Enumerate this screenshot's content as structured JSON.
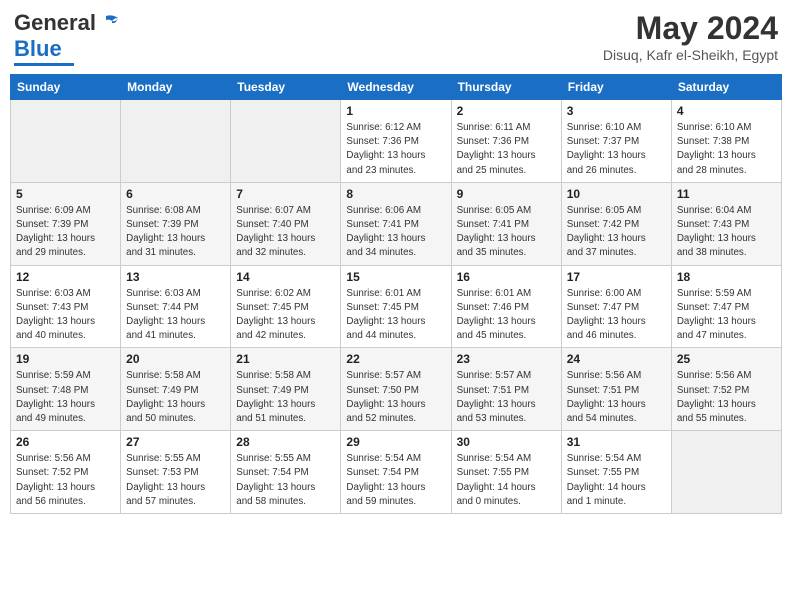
{
  "header": {
    "logo_general": "General",
    "logo_blue": "Blue",
    "month_title": "May 2024",
    "location": "Disuq, Kafr el-Sheikh, Egypt"
  },
  "days_of_week": [
    "Sunday",
    "Monday",
    "Tuesday",
    "Wednesday",
    "Thursday",
    "Friday",
    "Saturday"
  ],
  "weeks": [
    [
      {
        "day": "",
        "info": ""
      },
      {
        "day": "",
        "info": ""
      },
      {
        "day": "",
        "info": ""
      },
      {
        "day": "1",
        "info": "Sunrise: 6:12 AM\nSunset: 7:36 PM\nDaylight: 13 hours\nand 23 minutes."
      },
      {
        "day": "2",
        "info": "Sunrise: 6:11 AM\nSunset: 7:36 PM\nDaylight: 13 hours\nand 25 minutes."
      },
      {
        "day": "3",
        "info": "Sunrise: 6:10 AM\nSunset: 7:37 PM\nDaylight: 13 hours\nand 26 minutes."
      },
      {
        "day": "4",
        "info": "Sunrise: 6:10 AM\nSunset: 7:38 PM\nDaylight: 13 hours\nand 28 minutes."
      }
    ],
    [
      {
        "day": "5",
        "info": "Sunrise: 6:09 AM\nSunset: 7:39 PM\nDaylight: 13 hours\nand 29 minutes."
      },
      {
        "day": "6",
        "info": "Sunrise: 6:08 AM\nSunset: 7:39 PM\nDaylight: 13 hours\nand 31 minutes."
      },
      {
        "day": "7",
        "info": "Sunrise: 6:07 AM\nSunset: 7:40 PM\nDaylight: 13 hours\nand 32 minutes."
      },
      {
        "day": "8",
        "info": "Sunrise: 6:06 AM\nSunset: 7:41 PM\nDaylight: 13 hours\nand 34 minutes."
      },
      {
        "day": "9",
        "info": "Sunrise: 6:05 AM\nSunset: 7:41 PM\nDaylight: 13 hours\nand 35 minutes."
      },
      {
        "day": "10",
        "info": "Sunrise: 6:05 AM\nSunset: 7:42 PM\nDaylight: 13 hours\nand 37 minutes."
      },
      {
        "day": "11",
        "info": "Sunrise: 6:04 AM\nSunset: 7:43 PM\nDaylight: 13 hours\nand 38 minutes."
      }
    ],
    [
      {
        "day": "12",
        "info": "Sunrise: 6:03 AM\nSunset: 7:43 PM\nDaylight: 13 hours\nand 40 minutes."
      },
      {
        "day": "13",
        "info": "Sunrise: 6:03 AM\nSunset: 7:44 PM\nDaylight: 13 hours\nand 41 minutes."
      },
      {
        "day": "14",
        "info": "Sunrise: 6:02 AM\nSunset: 7:45 PM\nDaylight: 13 hours\nand 42 minutes."
      },
      {
        "day": "15",
        "info": "Sunrise: 6:01 AM\nSunset: 7:45 PM\nDaylight: 13 hours\nand 44 minutes."
      },
      {
        "day": "16",
        "info": "Sunrise: 6:01 AM\nSunset: 7:46 PM\nDaylight: 13 hours\nand 45 minutes."
      },
      {
        "day": "17",
        "info": "Sunrise: 6:00 AM\nSunset: 7:47 PM\nDaylight: 13 hours\nand 46 minutes."
      },
      {
        "day": "18",
        "info": "Sunrise: 5:59 AM\nSunset: 7:47 PM\nDaylight: 13 hours\nand 47 minutes."
      }
    ],
    [
      {
        "day": "19",
        "info": "Sunrise: 5:59 AM\nSunset: 7:48 PM\nDaylight: 13 hours\nand 49 minutes."
      },
      {
        "day": "20",
        "info": "Sunrise: 5:58 AM\nSunset: 7:49 PM\nDaylight: 13 hours\nand 50 minutes."
      },
      {
        "day": "21",
        "info": "Sunrise: 5:58 AM\nSunset: 7:49 PM\nDaylight: 13 hours\nand 51 minutes."
      },
      {
        "day": "22",
        "info": "Sunrise: 5:57 AM\nSunset: 7:50 PM\nDaylight: 13 hours\nand 52 minutes."
      },
      {
        "day": "23",
        "info": "Sunrise: 5:57 AM\nSunset: 7:51 PM\nDaylight: 13 hours\nand 53 minutes."
      },
      {
        "day": "24",
        "info": "Sunrise: 5:56 AM\nSunset: 7:51 PM\nDaylight: 13 hours\nand 54 minutes."
      },
      {
        "day": "25",
        "info": "Sunrise: 5:56 AM\nSunset: 7:52 PM\nDaylight: 13 hours\nand 55 minutes."
      }
    ],
    [
      {
        "day": "26",
        "info": "Sunrise: 5:56 AM\nSunset: 7:52 PM\nDaylight: 13 hours\nand 56 minutes."
      },
      {
        "day": "27",
        "info": "Sunrise: 5:55 AM\nSunset: 7:53 PM\nDaylight: 13 hours\nand 57 minutes."
      },
      {
        "day": "28",
        "info": "Sunrise: 5:55 AM\nSunset: 7:54 PM\nDaylight: 13 hours\nand 58 minutes."
      },
      {
        "day": "29",
        "info": "Sunrise: 5:54 AM\nSunset: 7:54 PM\nDaylight: 13 hours\nand 59 minutes."
      },
      {
        "day": "30",
        "info": "Sunrise: 5:54 AM\nSunset: 7:55 PM\nDaylight: 14 hours\nand 0 minutes."
      },
      {
        "day": "31",
        "info": "Sunrise: 5:54 AM\nSunset: 7:55 PM\nDaylight: 14 hours\nand 1 minute."
      },
      {
        "day": "",
        "info": ""
      }
    ]
  ]
}
